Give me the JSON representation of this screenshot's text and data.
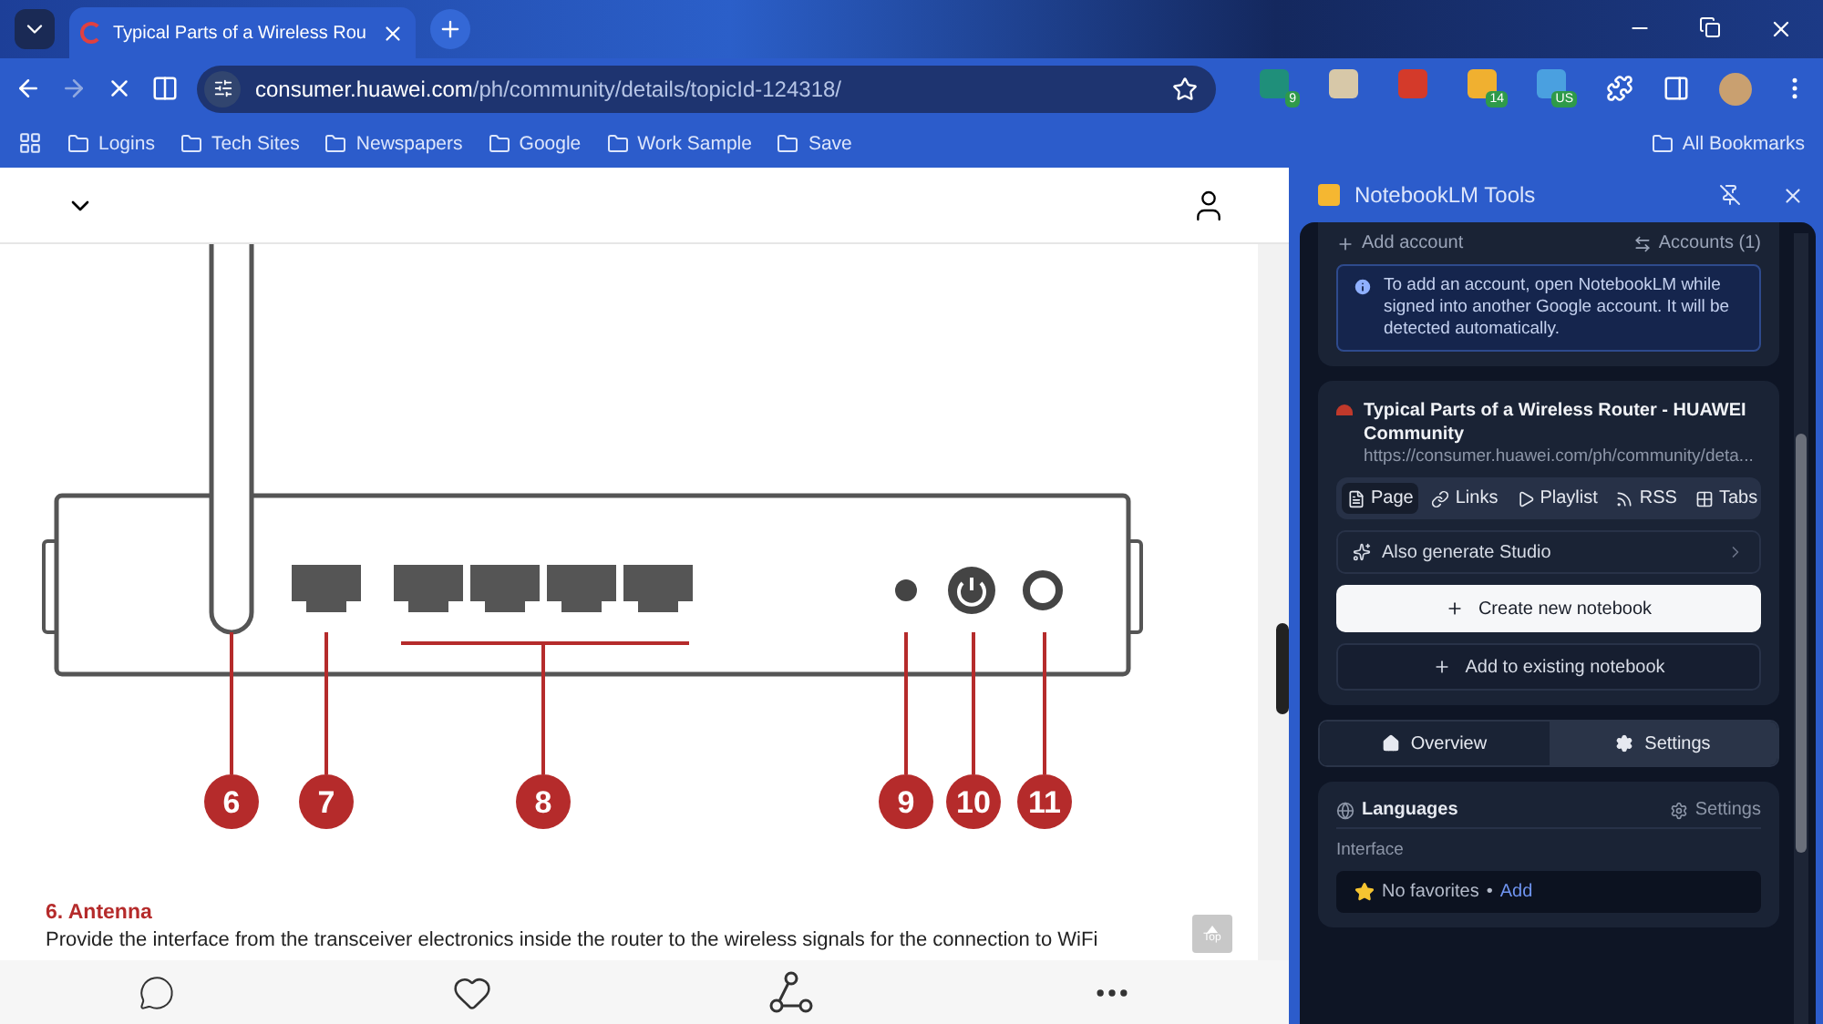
{
  "browser": {
    "tabs": [
      {
        "title": "Typical Parts of a Wireless Rou",
        "selected": true
      }
    ],
    "address": {
      "host": "consumer.huawei.com",
      "path": "/ph/community/details/topicId-124318/"
    },
    "extension_badges": [
      "9",
      "14",
      "US"
    ],
    "bookmarks": [
      "Logins",
      "Tech Sites",
      "Newspapers",
      "Google",
      "Work Sample",
      "Save"
    ],
    "all_bookmarks": "All Bookmarks"
  },
  "page": {
    "callouts": [
      "6",
      "7",
      "8",
      "9",
      "10",
      "11"
    ],
    "heading": "6. Antenna",
    "paragraph": "Provide the interface from the transceiver electronics inside the router to the wireless signals for the connection to WiFi",
    "top_button": "Top"
  },
  "panel": {
    "title": "NotebookLM Tools",
    "add_account": "Add account",
    "accounts": "Accounts (1)",
    "info": "To add an account, open NotebookLM while signed into another Google account. It will be detected automatically.",
    "source_title": "Typical Parts of a Wireless Router - HUAWEI Community",
    "source_url": "https://consumer.huawei.com/ph/community/deta...",
    "source_tabs": [
      {
        "kind": "page",
        "label": "Page",
        "selected": true
      },
      {
        "kind": "links",
        "label": "Links",
        "selected": false
      },
      {
        "kind": "playlist",
        "label": "Playlist",
        "selected": false
      },
      {
        "kind": "rss",
        "label": "RSS",
        "selected": false
      },
      {
        "kind": "tabs",
        "label": "Tabs",
        "selected": false
      }
    ],
    "studio": "Also generate Studio",
    "create": "Create new notebook",
    "add_existing": "Add to existing notebook",
    "view_tabs": [
      {
        "kind": "overview",
        "label": "Overview",
        "selected": true
      },
      {
        "kind": "settings",
        "label": "Settings",
        "selected": false
      }
    ],
    "languages": {
      "title": "Languages",
      "settings": "Settings",
      "section": "Interface",
      "favorites": "No favorites",
      "separator": "•",
      "add": "Add"
    }
  }
}
